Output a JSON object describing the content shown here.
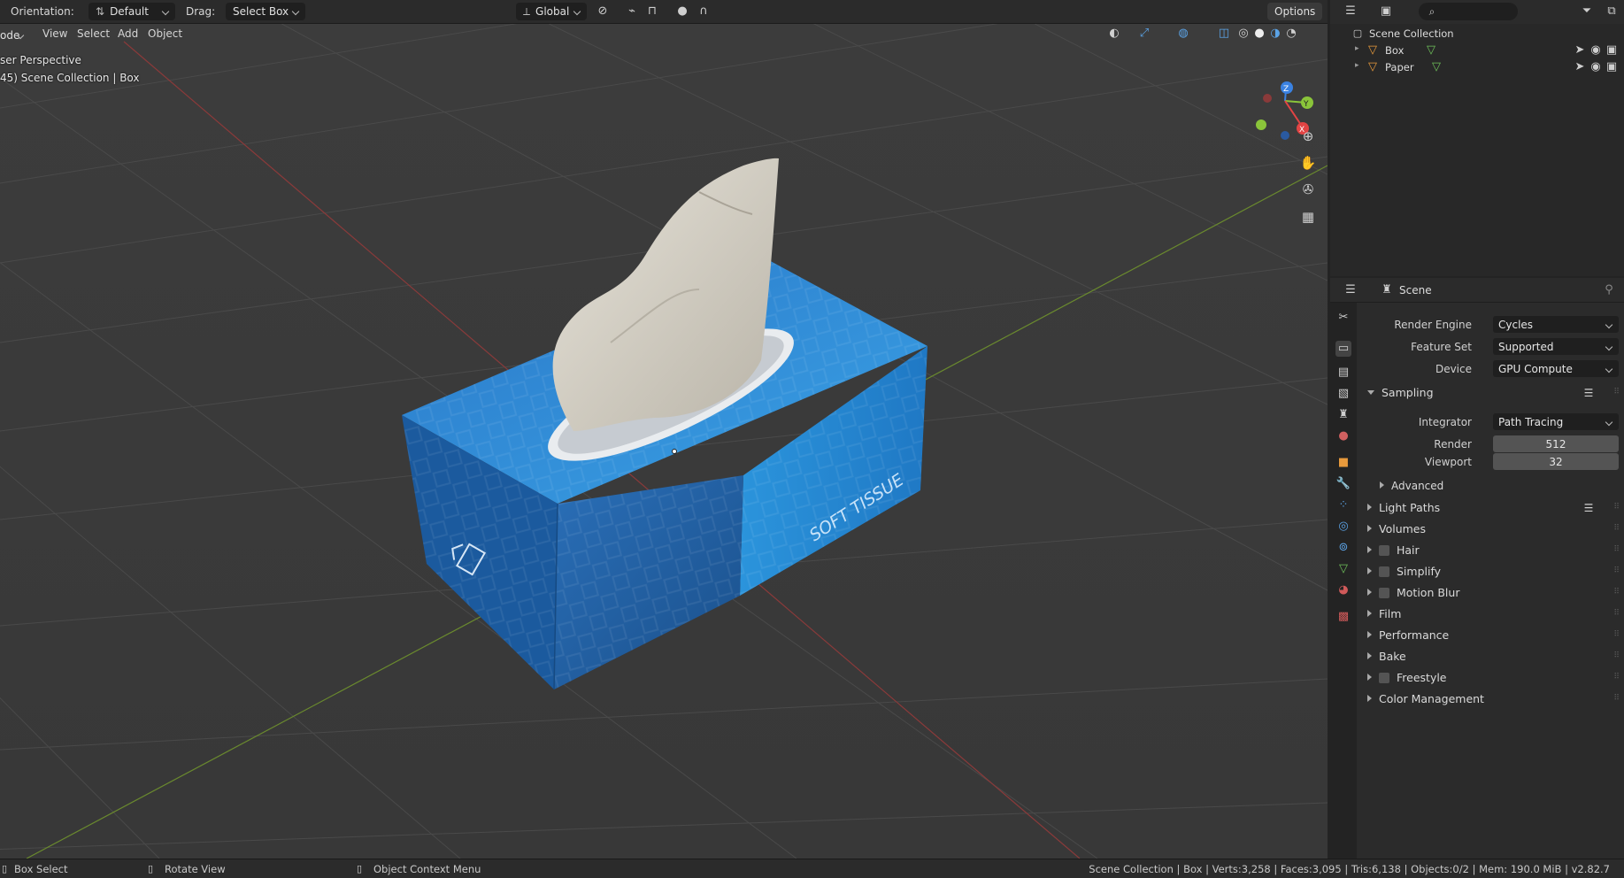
{
  "header": {
    "orientation_label": "Orientation:",
    "orientation_value": "Default",
    "drag_label": "Drag:",
    "drag_value": "Select Box",
    "transform_space": "Global",
    "options_label": "Options"
  },
  "menu": {
    "mode": "ode",
    "items": [
      "View",
      "Select",
      "Add",
      "Object"
    ]
  },
  "viewport": {
    "perspective": "ser Perspective",
    "collection_info": "45) Scene Collection | Box",
    "box_text": "SOFT TISSUE"
  },
  "outliner": {
    "root": "Scene Collection",
    "objects": [
      {
        "name": "Box"
      },
      {
        "name": "Paper"
      }
    ]
  },
  "properties": {
    "scene_label": "Scene",
    "render_engine_label": "Render Engine",
    "render_engine_value": "Cycles",
    "feature_set_label": "Feature Set",
    "feature_set_value": "Supported",
    "device_label": "Device",
    "device_value": "GPU Compute",
    "sampling_label": "Sampling",
    "integrator_label": "Integrator",
    "integrator_value": "Path Tracing",
    "render_label": "Render",
    "render_value": "512",
    "viewport_label": "Viewport",
    "viewport_value": "32",
    "advanced_label": "Advanced",
    "sections": [
      {
        "label": "Light Paths",
        "checkbox": false
      },
      {
        "label": "Volumes",
        "checkbox": false
      },
      {
        "label": "Hair",
        "checkbox": true
      },
      {
        "label": "Simplify",
        "checkbox": true
      },
      {
        "label": "Motion Blur",
        "checkbox": true
      },
      {
        "label": "Film",
        "checkbox": false
      },
      {
        "label": "Performance",
        "checkbox": false
      },
      {
        "label": "Bake",
        "checkbox": false
      },
      {
        "label": "Freestyle",
        "checkbox": true
      },
      {
        "label": "Color Management",
        "checkbox": false
      }
    ]
  },
  "status": {
    "box_select": "Box Select",
    "rotate_view": "Rotate View",
    "context_menu": "Object Context Menu",
    "stats": "Scene Collection | Box | Verts:3,258 | Faces:3,095 | Tris:6,138 | Objects:0/2 | Mem: 190.0 MiB | v2.82.7"
  },
  "colors": {
    "x_axis": "#8a3a3a",
    "y_axis": "#6a8a2e",
    "box_dark": "#1f5fa3",
    "box_light": "#2a8fd8",
    "tissue": "#d9d4c8",
    "gizmo_x": "#e24444",
    "gizmo_y": "#8ac43a",
    "gizmo_z": "#3a82e2"
  }
}
